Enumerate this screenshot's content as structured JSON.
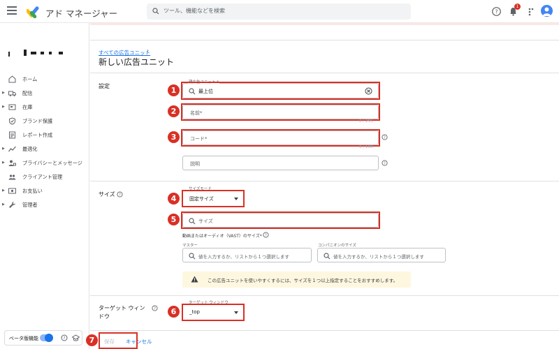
{
  "app": {
    "title": "アド マネージャー"
  },
  "search": {
    "placeholder": "ツール、機能などを検索"
  },
  "notifications": {
    "count": "1"
  },
  "sidebar": {
    "items": [
      {
        "label": "ホーム",
        "icon": "home-icon",
        "expandable": false
      },
      {
        "label": "配信",
        "icon": "truck-icon",
        "expandable": true
      },
      {
        "label": "在庫",
        "icon": "inventory-icon",
        "expandable": true
      },
      {
        "label": "ブランド保護",
        "icon": "shield-icon",
        "expandable": false
      },
      {
        "label": "レポート作成",
        "icon": "report-icon",
        "expandable": false
      },
      {
        "label": "最適化",
        "icon": "trend-icon",
        "expandable": true
      },
      {
        "label": "プライバシーとメッセージ",
        "icon": "privacy-icon",
        "expandable": true
      },
      {
        "label": "クライアント管理",
        "icon": "people-icon",
        "expandable": false
      },
      {
        "label": "お支払い",
        "icon": "payment-icon",
        "expandable": true
      },
      {
        "label": "管理者",
        "icon": "wrench-icon",
        "expandable": true
      }
    ],
    "beta_label": "ベータ版機能"
  },
  "breadcrumb": {
    "parent": "すべての広告ユニット",
    "separator": "›"
  },
  "page": {
    "title": "新しい広告ユニット"
  },
  "settings": {
    "section_label": "設定",
    "parent_unit": {
      "label": "親広告ユニット *",
      "value": "最上位"
    },
    "name": {
      "placeholder": "名前*",
      "counter": "0 / 255"
    },
    "code": {
      "placeholder": "コード*",
      "counter": "0 / 100"
    },
    "description": {
      "placeholder": "説明"
    }
  },
  "size": {
    "section_label": "サイズ",
    "mode": {
      "label": "サイズモード",
      "value": "固定サイズ"
    },
    "size_search": {
      "placeholder": "サイズ"
    },
    "video_label": "動画またはオーディオ（VAST）のサイズ*",
    "master": {
      "label": "マスター",
      "placeholder": "値を入力するか、リストから１つ選択します"
    },
    "companion": {
      "label": "コンパニオンのサイズ",
      "placeholder": "値を入力するか、リストから１つ選択します"
    },
    "notice": "この広告ユニットを使いやすくするには、サイズを１つ以上指定することをおすすめします。"
  },
  "target_window": {
    "section_label_line1": "ターゲット ウィン",
    "section_label_line2": "ドウ",
    "field_label": "ターゲット ウィンドウ",
    "value": "_top"
  },
  "footer": {
    "save": "保存",
    "cancel": "キャンセル"
  },
  "annotations": [
    "1",
    "2",
    "3",
    "4",
    "5",
    "6",
    "7"
  ],
  "colors": {
    "accent": "#1a73e8",
    "annotation": "#d93025",
    "notice_bg": "#fef7e0"
  }
}
